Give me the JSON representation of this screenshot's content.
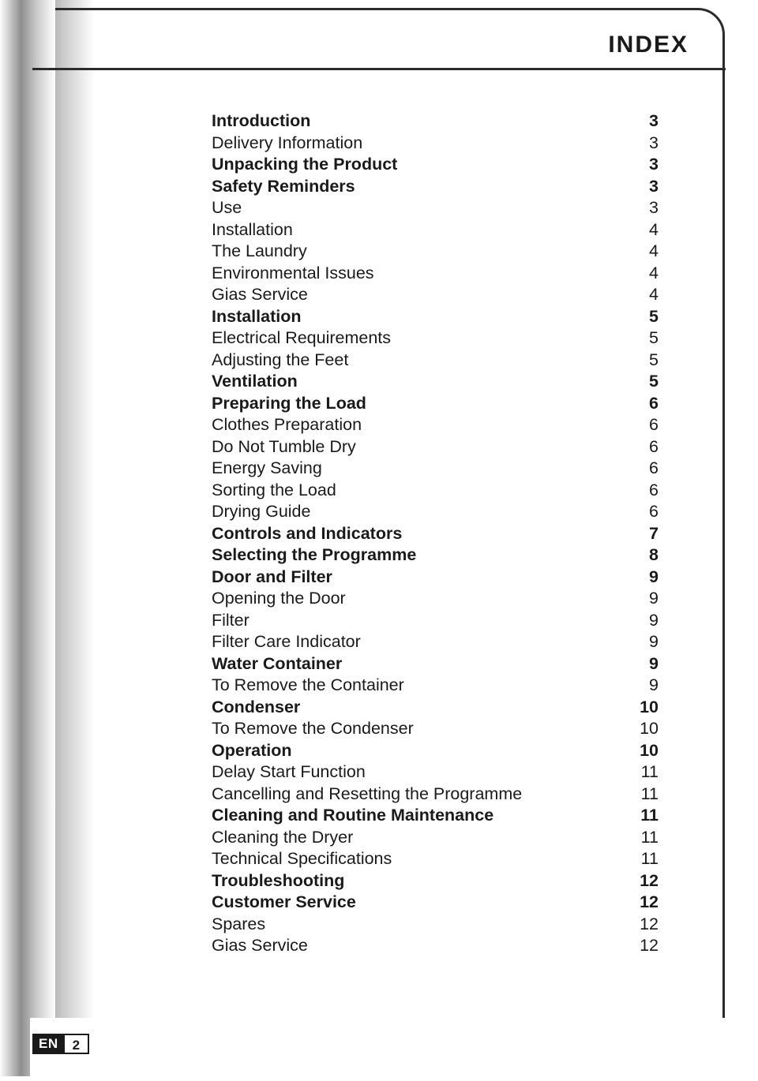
{
  "header": {
    "title": "INDEX"
  },
  "index": {
    "entries": [
      {
        "title": "Introduction",
        "page": "3",
        "bold": true
      },
      {
        "title": "Delivery Information",
        "page": "3",
        "bold": false
      },
      {
        "title": "Unpacking the Product",
        "page": "3",
        "bold": true
      },
      {
        "title": "Safety Reminders",
        "page": "3",
        "bold": true
      },
      {
        "title": "Use",
        "page": "3",
        "bold": false
      },
      {
        "title": "Installation",
        "page": "4",
        "bold": false
      },
      {
        "title": "The Laundry",
        "page": "4",
        "bold": false
      },
      {
        "title": "Environmental Issues",
        "page": "4",
        "bold": false
      },
      {
        "title": "Gias Service",
        "page": "4",
        "bold": false
      },
      {
        "title": "Installation",
        "page": "5",
        "bold": true
      },
      {
        "title": "Electrical Requirements",
        "page": "5",
        "bold": false
      },
      {
        "title": "Adjusting the Feet",
        "page": "5",
        "bold": false
      },
      {
        "title": "Ventilation",
        "page": "5",
        "bold": true
      },
      {
        "title": "Preparing the Load",
        "page": "6",
        "bold": true
      },
      {
        "title": "Clothes Preparation",
        "page": "6",
        "bold": false
      },
      {
        "title": "Do Not Tumble Dry",
        "page": "6",
        "bold": false
      },
      {
        "title": "Energy Saving",
        "page": "6",
        "bold": false
      },
      {
        "title": "Sorting the Load",
        "page": "6",
        "bold": false
      },
      {
        "title": "Drying Guide",
        "page": "6",
        "bold": false
      },
      {
        "title": "Controls and Indicators",
        "page": "7",
        "bold": true
      },
      {
        "title": "Selecting the Programme",
        "page": "8",
        "bold": true
      },
      {
        "title": "Door and Filter",
        "page": "9",
        "bold": true
      },
      {
        "title": "Opening the Door",
        "page": "9",
        "bold": false
      },
      {
        "title": "Filter",
        "page": "9",
        "bold": false
      },
      {
        "title": "Filter Care Indicator",
        "page": "9",
        "bold": false
      },
      {
        "title": "Water Container",
        "page": "9",
        "bold": true
      },
      {
        "title": "To Remove the Container",
        "page": "9",
        "bold": false
      },
      {
        "title": "Condenser",
        "page": "10",
        "bold": true
      },
      {
        "title": "To Remove the Condenser",
        "page": "10",
        "bold": false
      },
      {
        "title": "Operation",
        "page": "10",
        "bold": true
      },
      {
        "title": "Delay Start Function",
        "page": "11",
        "bold": false
      },
      {
        "title": "Cancelling and Resetting the Programme",
        "page": "11",
        "bold": false
      },
      {
        "title": "Cleaning and Routine Maintenance",
        "page": "11",
        "bold": true
      },
      {
        "title": "Cleaning the Dryer",
        "page": "11",
        "bold": false
      },
      {
        "title": "Technical Specifications",
        "page": "11",
        "bold": false
      },
      {
        "title": "Troubleshooting",
        "page": "12",
        "bold": true
      },
      {
        "title": "Customer Service",
        "page": "12",
        "bold": true
      },
      {
        "title": "Spares",
        "page": "12",
        "bold": false
      },
      {
        "title": "Gias Service",
        "page": "12",
        "bold": false
      }
    ]
  },
  "footer": {
    "language": "EN",
    "page_number": "2"
  }
}
